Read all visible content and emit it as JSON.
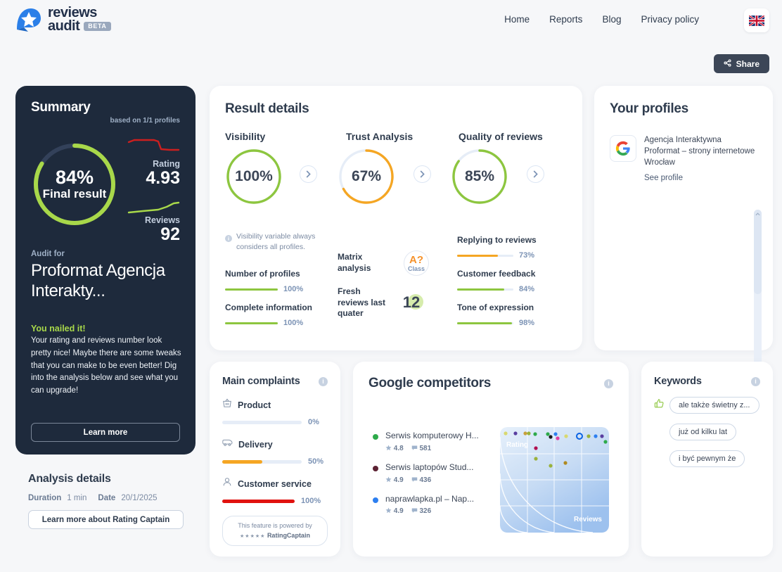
{
  "header": {
    "logo_line1": "reviews",
    "logo_line2": "audit",
    "beta_badge": "BETA",
    "nav": [
      {
        "label": "Home"
      },
      {
        "label": "Reports"
      },
      {
        "label": "Blog"
      },
      {
        "label": "Privacy policy"
      }
    ],
    "language_icon": "uk-flag-icon"
  },
  "share": {
    "label": "Share",
    "icon": "share-icon"
  },
  "summary": {
    "title": "Summary",
    "based_on": "based on 1/1 profiles",
    "final_pct": "84%",
    "final_label": "Final result",
    "final_value": 84,
    "rating_label": "Rating",
    "rating_value": "4.93",
    "reviews_label": "Reviews",
    "reviews_value": "92",
    "audit_for_label": "Audit for",
    "business_name": "Proformat Agencja Interakty...",
    "verdict_title": "You nailed it!",
    "verdict_body": "Your rating and reviews number look pretty nice! Maybe there are some tweaks that you can make to be even better! Dig into the analysis below and see what you can upgrade!",
    "learn_more_label": "Learn more"
  },
  "analysis_details": {
    "title": "Analysis details",
    "duration_label": "Duration",
    "duration_value": "1 min",
    "date_label": "Date",
    "date_value": "20/1/2025",
    "cta_label": "Learn more about Rating Captain"
  },
  "result_details": {
    "title": "Result details",
    "columns": [
      {
        "title": "Visibility",
        "pct": "100%",
        "value": 100,
        "color": "#8dc63f"
      },
      {
        "title": "Trust Analysis",
        "pct": "67%",
        "value": 67,
        "color": "#f5a623"
      },
      {
        "title": "Quality of reviews",
        "pct": "85%",
        "value": 85,
        "color": "#8dc63f"
      }
    ],
    "visibility_note": "Visibility variable always considers all profiles.",
    "visibility_bars": [
      {
        "label": "Number of profiles",
        "pct": "100%",
        "value": 100,
        "color": "#8dc63f"
      },
      {
        "label": "Complete information",
        "pct": "100%",
        "value": 100,
        "color": "#8dc63f"
      }
    ],
    "trust_items": [
      {
        "label": "Matrix analysis",
        "badge_value": "A?",
        "badge_caption": "Class"
      },
      {
        "label": "Fresh reviews last quater",
        "number": "12"
      }
    ],
    "quality_bars": [
      {
        "label": "Replying to reviews",
        "pct": "73%",
        "value": 73,
        "color": "#f5a623"
      },
      {
        "label": "Customer feedback",
        "pct": "84%",
        "value": 84,
        "color": "#8dc63f"
      },
      {
        "label": "Tone of expression",
        "pct": "98%",
        "value": 98,
        "color": "#8dc63f"
      }
    ]
  },
  "profiles": {
    "title": "Your profiles",
    "items": [
      {
        "icon": "google-icon",
        "name": "Agencja Interaktywna Proformat – strony internetowe Wrocław",
        "link_label": "See profile"
      }
    ]
  },
  "complaints": {
    "title": "Main complaints",
    "info_icon": "info-icon",
    "items": [
      {
        "icon": "basket-icon",
        "label": "Product",
        "pct": "0%",
        "value": 0,
        "color": "#e6edf7"
      },
      {
        "icon": "delivery-van-icon",
        "label": "Delivery",
        "pct": "50%",
        "value": 50,
        "color": "#f5a623"
      },
      {
        "icon": "person-icon",
        "label": "Customer service",
        "pct": "100%",
        "value": 100,
        "color": "#e1120f"
      }
    ],
    "powered_line1": "This feature is powered by",
    "powered_stars": "★★★★★",
    "powered_brand": "RatingCaptain"
  },
  "competitors": {
    "title": "Google competitors",
    "info_icon": "info-icon",
    "items": [
      {
        "name": "Serwis komputerowy H...",
        "rating": "4.8",
        "reviews": "581",
        "color": "#2eaa4a"
      },
      {
        "name": "Serwis laptopów Stud...",
        "rating": "4.9",
        "reviews": "436",
        "color": "#5c2233"
      },
      {
        "name": "naprawlapka.pl – Nap...",
        "rating": "4.9",
        "reviews": "326",
        "color": "#2d7ff0"
      }
    ],
    "matrix": {
      "y_axis_label": "Rating",
      "x_axis_label": "Reviews"
    }
  },
  "keywords": {
    "title": "Keywords",
    "info_icon": "info-icon",
    "thumb_icon": "thumbs-up-icon",
    "items": [
      {
        "label": "ale także świetny z..."
      },
      {
        "label": "już od kilku lat"
      },
      {
        "label": "i być pewnym że"
      }
    ]
  },
  "chart_data": {
    "type": "scatter",
    "title": "Competitor matrix",
    "xlabel": "Reviews",
    "ylabel": "Rating",
    "xlim": [
      0,
      100
    ],
    "ylim": [
      0,
      100
    ],
    "grid": true,
    "points": [
      {
        "x": 3,
        "y": 96,
        "color": "#d8d870"
      },
      {
        "x": 12,
        "y": 96,
        "color": "#5a3fa0"
      },
      {
        "x": 22,
        "y": 96,
        "color": "#c8a13c"
      },
      {
        "x": 26,
        "y": 96,
        "color": "#9ab23c"
      },
      {
        "x": 33,
        "y": 95,
        "color": "#2eaa4a"
      },
      {
        "x": 46,
        "y": 95,
        "color": "#2eaa4a"
      },
      {
        "x": 50,
        "y": 94,
        "color": "#1a1a1a"
      },
      {
        "x": 54,
        "y": 95,
        "color": "#2d7ff0"
      },
      {
        "x": 57,
        "y": 92,
        "color": "#e040a0"
      },
      {
        "x": 64,
        "y": 93,
        "color": "#d8d870"
      },
      {
        "x": 79,
        "y": 93,
        "color": "#2d7ff0"
      },
      {
        "x": 86,
        "y": 93,
        "color": "#9ab23c"
      },
      {
        "x": 93,
        "y": 93,
        "color": "#2d7ff0"
      },
      {
        "x": 96,
        "y": 93,
        "color": "#5a3fa0"
      },
      {
        "x": 99,
        "y": 89,
        "color": "#2eaa4a"
      },
      {
        "x": 34,
        "y": 84,
        "color": "#b01050"
      },
      {
        "x": 34,
        "y": 74,
        "color": "#9ab23c"
      },
      {
        "x": 50,
        "y": 66,
        "color": "#9ab23c"
      },
      {
        "x": 63,
        "y": 68,
        "color": "#b08a20"
      }
    ]
  }
}
